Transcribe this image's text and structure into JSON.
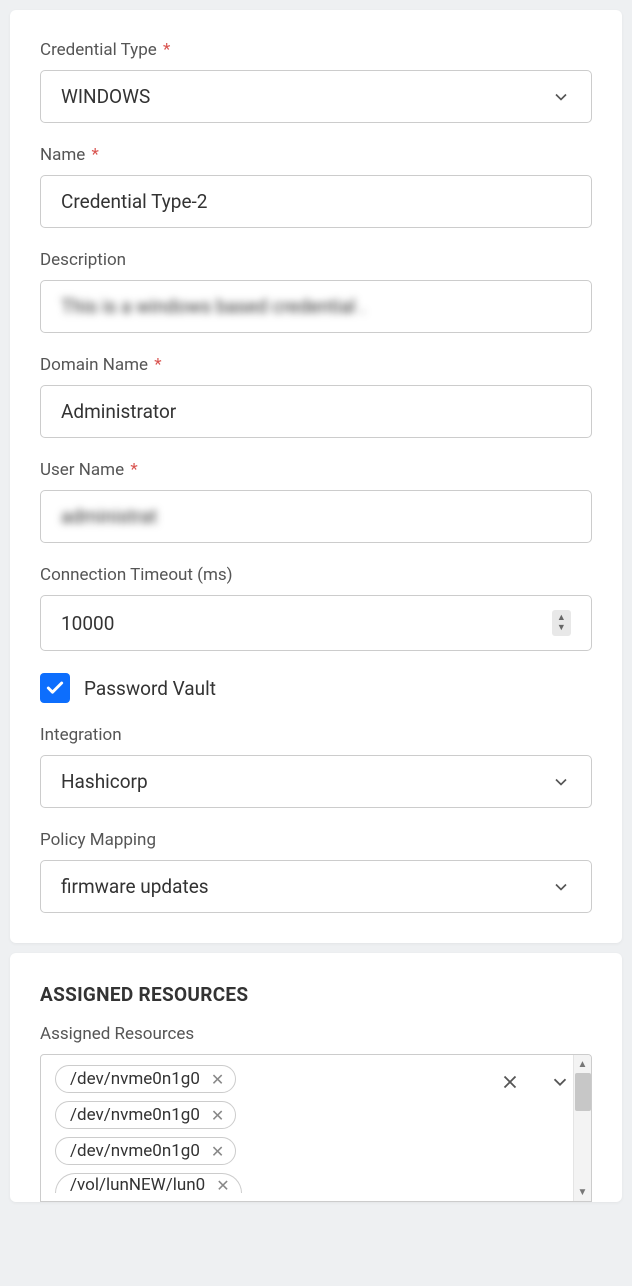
{
  "form": {
    "credential_type": {
      "label": "Credential Type",
      "value": "WINDOWS",
      "required": true
    },
    "name": {
      "label": "Name",
      "value": "Credential Type-2",
      "required": true
    },
    "description": {
      "label": "Description",
      "value": "This is a windows based credential ."
    },
    "domain_name": {
      "label": "Domain Name",
      "value": "Administrator",
      "required": true
    },
    "user_name": {
      "label": "User Name",
      "value": "administrat",
      "required": true
    },
    "connection_timeout": {
      "label": "Connection Timeout (ms)",
      "value": "10000"
    },
    "password_vault": {
      "label": "Password Vault",
      "checked": true
    },
    "integration": {
      "label": "Integration",
      "value": "Hashicorp"
    },
    "policy_mapping": {
      "label": "Policy Mapping",
      "value": "firmware updates"
    }
  },
  "assigned_resources": {
    "title": "ASSIGNED RESOURCES",
    "label": "Assigned Resources",
    "tags": [
      "/dev/nvme0n1g0",
      "/dev/nvme0n1g0",
      "/dev/nvme0n1g0",
      "/vol/lunNEW/lun0"
    ]
  }
}
